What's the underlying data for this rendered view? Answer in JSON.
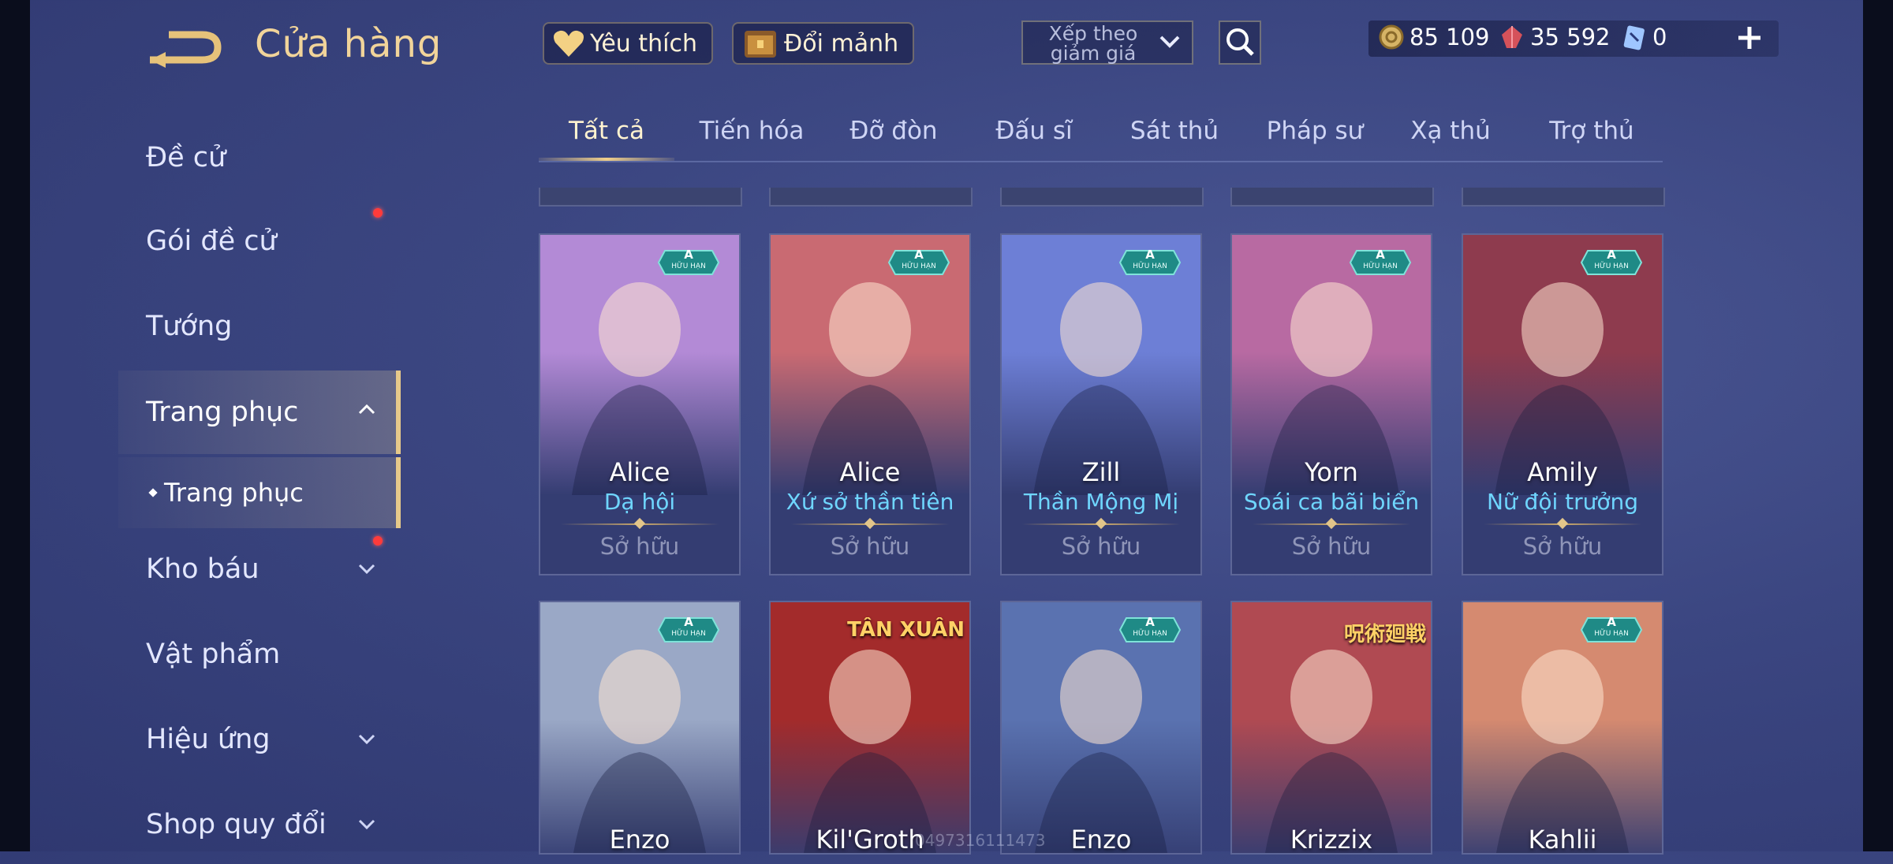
{
  "header": {
    "title": "Cửa hàng"
  },
  "sidebar": {
    "items": [
      {
        "label": "Đề cử"
      },
      {
        "label": "Gói đề cử"
      },
      {
        "label": "Tướng"
      },
      {
        "label": "Trang phục"
      },
      {
        "label": "Kho báu"
      },
      {
        "label": "Vật phẩm"
      },
      {
        "label": "Hiệu ứng"
      },
      {
        "label": "Shop quy đổi"
      }
    ],
    "subitem": {
      "label": "Trang phục"
    }
  },
  "topbar": {
    "favorite_label": "Yêu thích",
    "exchange_label": "Đổi mảnh",
    "sort_label": "Xếp theo giảm giá"
  },
  "currency": [
    {
      "icon": "gold-coin-icon",
      "value": "85 109"
    },
    {
      "icon": "ruby-icon",
      "value": "35 592"
    },
    {
      "icon": "voucher-icon",
      "value": "0"
    }
  ],
  "tabs": [
    {
      "label": "Tất cả"
    },
    {
      "label": "Tiến hóa"
    },
    {
      "label": "Đỡ đòn"
    },
    {
      "label": "Đấu sĩ"
    },
    {
      "label": "Sát thủ"
    },
    {
      "label": "Pháp sư"
    },
    {
      "label": "Xạ thủ"
    },
    {
      "label": "Trợ thủ"
    }
  ],
  "badge": {
    "grade": "A",
    "text": "HỮU HẠN"
  },
  "cards": [
    {
      "hero": "Alice",
      "skin": "Dạ hội",
      "status": "Sở hữu",
      "color": "#b38ad6"
    },
    {
      "hero": "Alice",
      "skin": "Xứ sở thần tiên",
      "status": "Sở hữu",
      "color": "#c96a72"
    },
    {
      "hero": "Zill",
      "skin": "Thần Mộng Mị",
      "status": "Sở hữu",
      "color": "#6d7fd6"
    },
    {
      "hero": "Yorn",
      "skin": "Soái ca bãi biển",
      "status": "Sở hữu",
      "color": "#b86aa2"
    },
    {
      "hero": "Amily",
      "skin": "Nữ đội trưởng",
      "status": "Sở hữu",
      "color": "#8e3b4e"
    },
    {
      "hero": "Enzo",
      "color": "#9aa8c6"
    },
    {
      "hero": "Kil'Groth",
      "banner": "TÂN XUÂN",
      "color": "#a32b2b"
    },
    {
      "hero": "Enzo",
      "color": "#5a72b0"
    },
    {
      "hero": "Krizzix",
      "banner": "呪術廻戦",
      "color": "#b04a52"
    },
    {
      "hero": "Kahlii",
      "color": "#d58a70"
    }
  ],
  "watermark": "0497316111473"
}
